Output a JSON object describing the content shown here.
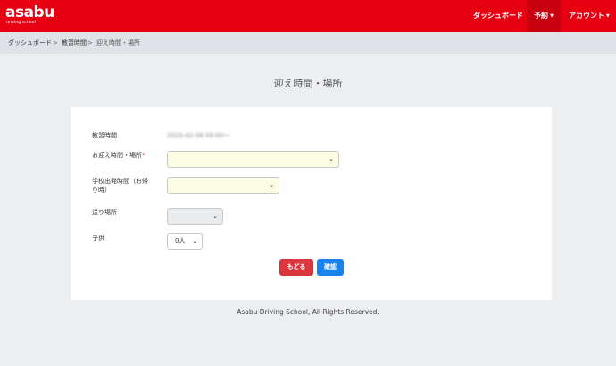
{
  "header": {
    "logo_text": "asabu",
    "logo_tagline": "driving school",
    "nav": {
      "dashboard": "ダッシュボード",
      "reservation": "予約",
      "account": "アカウント"
    }
  },
  "breadcrumb": {
    "items": [
      "ダッシュボード",
      "教習時間",
      "迎え時間・場所"
    ],
    "separator": ">"
  },
  "page_title": "迎え時間・場所",
  "form": {
    "lesson_time_label": "教習時間",
    "lesson_time_value": "2023-02-08 09:00〜",
    "pickup_label": "お迎え時間・場所",
    "required_mark": "*",
    "pickup_value": "",
    "departure_label_line1": "学校出発時間（お帰",
    "departure_label_line2": "り時）",
    "departure_value": "",
    "dropoff_label": "送り場所",
    "dropoff_value": "",
    "children_label": "子供",
    "children_value": "0人",
    "back_button": "もどる",
    "confirm_button": "確認"
  },
  "footer": "Asabu Driving School, All Rights Reserved.",
  "colors": {
    "brand_red": "#e60012",
    "back_button": "#d9363e",
    "confirm_button": "#1a82ef",
    "field_highlight": "#fdfde4"
  }
}
